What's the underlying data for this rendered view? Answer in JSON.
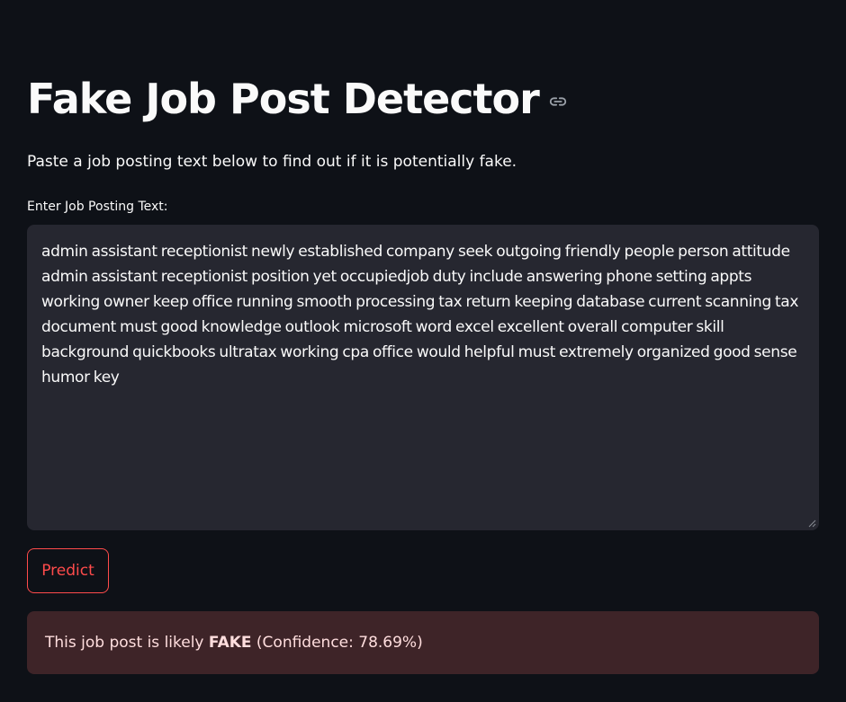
{
  "header": {
    "title": "Fake Job Post Detector",
    "link_icon": "link-icon"
  },
  "intro": {
    "text": "Paste a job posting text below to find out if it is potentially fake."
  },
  "input": {
    "label": "Enter Job Posting Text:",
    "value": "admin assistant receptionist newly established company seek outgoing friendly people person attitude admin assistant receptionist position yet occupiedjob duty include answering phone setting appts working owner keep office running smooth processing tax return keeping database current scanning tax document must good knowledge outlook microsoft word excel excellent overall computer skill background quickbooks ultratax working cpa office would helpful must extremely organized good sense humor key"
  },
  "actions": {
    "predict_label": "Predict"
  },
  "result": {
    "prefix": "This job post is likely ",
    "verdict": "FAKE",
    "suffix": " (Confidence: 78.69%)"
  },
  "colors": {
    "background": "#0e1117",
    "input_bg": "#262730",
    "accent": "#ff4b4b",
    "error_bg": "#3e2428",
    "error_text": "#ffdede"
  }
}
